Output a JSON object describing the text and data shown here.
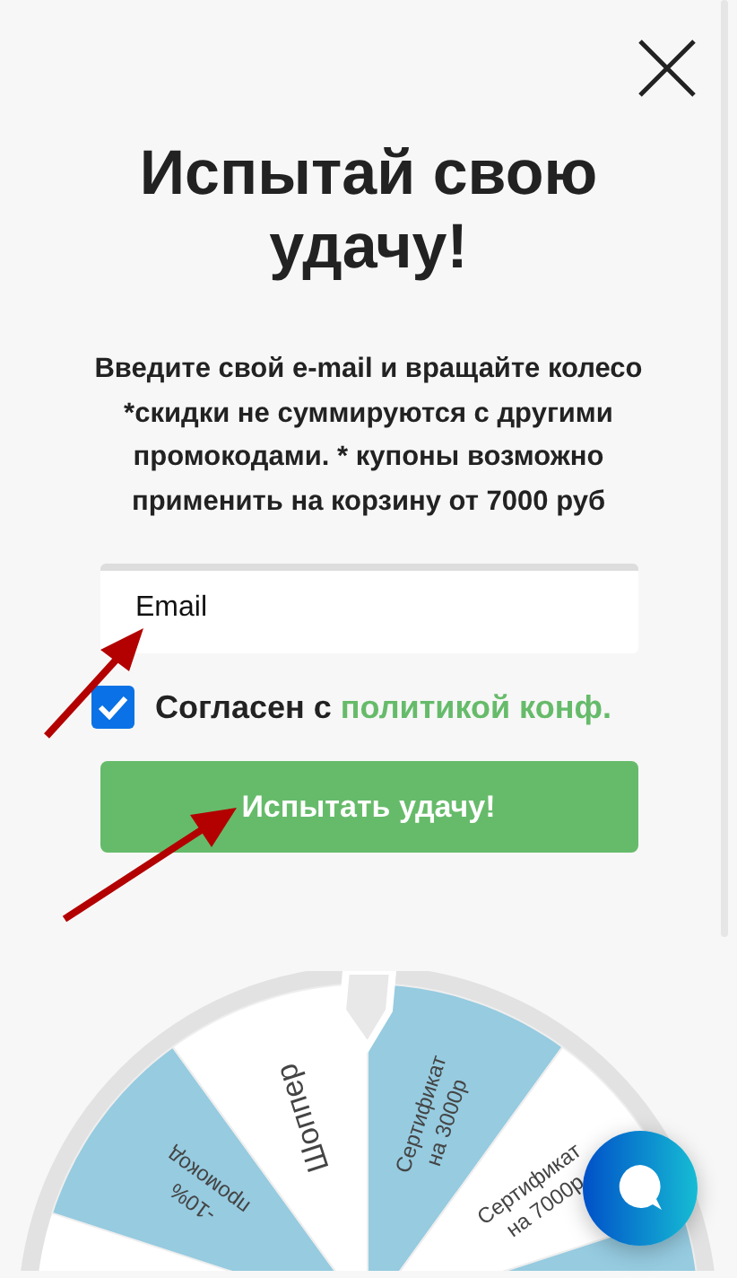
{
  "title": "Испытай свою удачу!",
  "description": "Введите свой e-mail и вращайте колесо *скидки не суммируются с другими промокодами. * купоны возможно применить на корзину от 7000 руб",
  "email_field": {
    "placeholder": "Email"
  },
  "consent": {
    "checked": true,
    "text": "Согласен с",
    "link": "политикой конф."
  },
  "submit_button": "Испытать удачу!",
  "wheel": {
    "segments": [
      {
        "color": "#96cbe0",
        "lines": [
          "-10%",
          "промокод"
        ]
      },
      {
        "color": "#ffffff",
        "lines": [
          "Шоппер"
        ]
      },
      {
        "color": "#96cbe0",
        "lines": [
          "Сертификат",
          "на 3000р"
        ]
      },
      {
        "color": "#ffffff",
        "lines": [
          "Сертификат",
          "на 7000р"
        ]
      },
      {
        "color": "#96cbe0"
      }
    ]
  }
}
